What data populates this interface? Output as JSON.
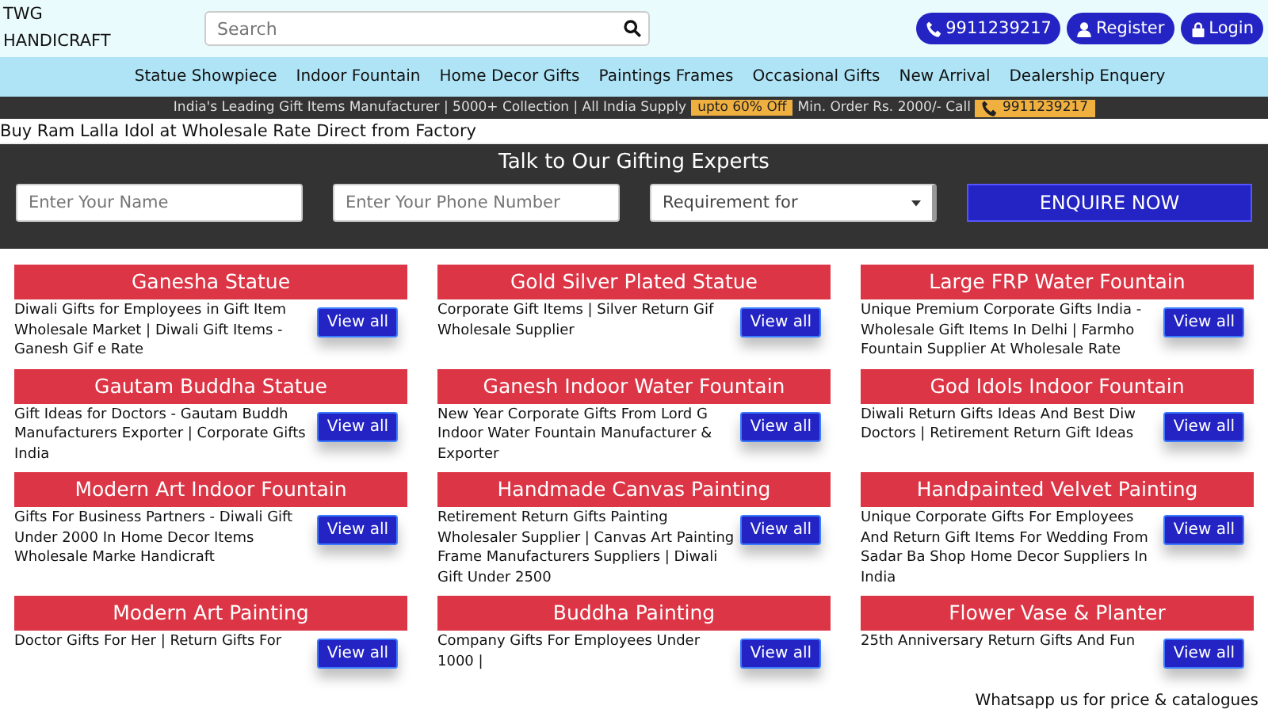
{
  "header": {
    "logo": "TWG HANDICRAFT",
    "search": {
      "placeholder": "Search"
    },
    "buttons": [
      {
        "kind": "phone",
        "label": "9911239217"
      },
      {
        "kind": "user",
        "label": "Register"
      },
      {
        "kind": "lock",
        "label": "Login"
      }
    ]
  },
  "nav": [
    "Statue Showpiece",
    "Indoor Fountain",
    "Home Decor Gifts",
    "Paintings Frames",
    "Occasional Gifts",
    "New Arrival",
    "Dealership Enquery"
  ],
  "promo": [
    {
      "kind": "text",
      "text": "India's Leading Gift Items Manufacturer | 5000+ Collection | All India Supply"
    },
    {
      "kind": "badge",
      "text": "upto 60% Off"
    },
    {
      "kind": "text",
      "text": "Min. Order Rs. 2000/- Call"
    },
    {
      "kind": "phone",
      "text": "9911239217"
    }
  ],
  "news": "Buy Ram Lalla Idol at Wholesale Rate Direct from Factory",
  "enquiry": {
    "title": "Talk to Our Gifting Experts",
    "name": {
      "placeholder": "Enter Your Name"
    },
    "phone": {
      "placeholder": "Enter Your Phone Number"
    },
    "requirement": {
      "value": "Requirement for"
    },
    "button": "ENQUIRE NOW"
  },
  "categories": [
    {
      "title": "Ganesha Statue",
      "description": "Diwali Gifts for Employees in Gift Item Wholesale Market | Diwali Gift Items - Ganesh Gif e Rate",
      "button": "View all"
    },
    {
      "title": "Gold Silver Plated Statue",
      "description": "Corporate Gift Items | Silver Return Gif Wholesale Supplier",
      "button": "View all"
    },
    {
      "title": "Large FRP Water Fountain",
      "description": "Unique Premium Corporate Gifts India - Wholesale Gift Items In Delhi | Farmho Fountain Supplier At Wholesale Rate",
      "button": "View all"
    },
    {
      "title": "Gautam Buddha Statue",
      "description": "Gift Ideas for Doctors - Gautam Buddh Manufacturers Exporter | Corporate Gifts India",
      "button": "View all"
    },
    {
      "title": "Ganesh Indoor Water Fountain",
      "description": "New Year Corporate Gifts From Lord G Indoor Water Fountain Manufacturer & Exporter",
      "button": "View all"
    },
    {
      "title": "God Idols Indoor Fountain",
      "description": "Diwali Return Gifts Ideas And Best Diw Doctors | Retirement Return Gift Ideas",
      "button": "View all"
    },
    {
      "title": "Modern Art Indoor Fountain",
      "description": "Gifts For Business Partners - Diwali Gift Under 2000 In Home Decor Items Wholesale Marke Handicraft",
      "button": "View all"
    },
    {
      "title": "Handmade Canvas Painting",
      "description": "Retirement Return Gifts Painting Wholesaler Supplier | Canvas Art Painting Frame Manufacturers Suppliers | Diwali Gift Under 2500",
      "button": "View all"
    },
    {
      "title": "Handpainted Velvet Painting",
      "description": "Unique Corporate Gifts For Employees And Return Gift Items For Wedding From Sadar Ba Shop Home Decor Suppliers In India",
      "button": "View all"
    },
    {
      "title": "Modern Art Painting",
      "description": "Doctor Gifts For Her | Return Gifts For",
      "button": "View all"
    },
    {
      "title": "Buddha Painting",
      "description": "Company Gifts For Employees Under 1000 |",
      "button": "View all"
    },
    {
      "title": "Flower Vase & Planter",
      "description": "25th Anniversary Return Gifts And Fun",
      "button": "View all"
    }
  ],
  "whatsapp": "Whatsapp us for price & catalogues"
}
